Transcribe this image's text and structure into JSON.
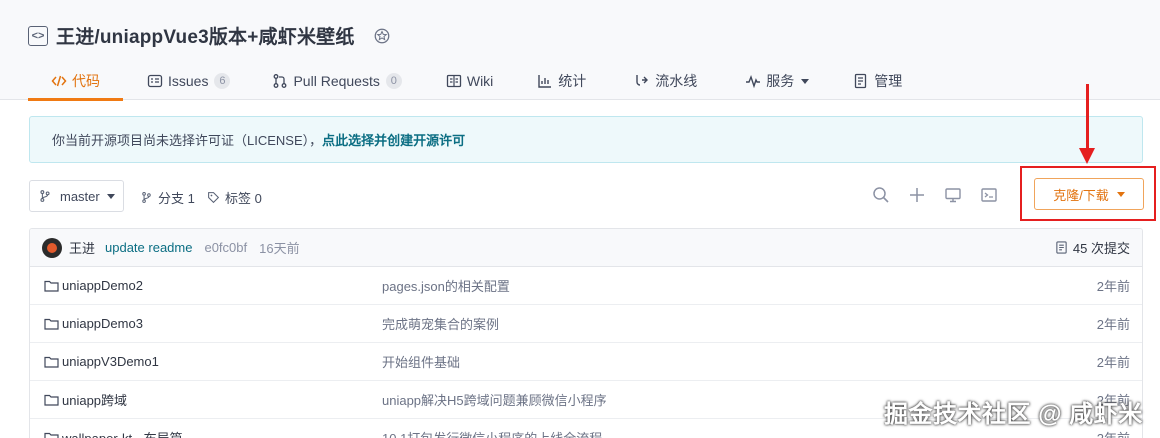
{
  "repo": {
    "title": "王进/uniappVue3版本+咸虾米壁纸"
  },
  "tabs": [
    {
      "label": "代码",
      "icon": "code-icon"
    },
    {
      "label": "Issues",
      "icon": "issues-icon",
      "count": "6"
    },
    {
      "label": "Pull Requests",
      "icon": "pull-request-icon",
      "count": "0"
    },
    {
      "label": "Wiki",
      "icon": "wiki-icon"
    },
    {
      "label": "统计",
      "icon": "chart-icon"
    },
    {
      "label": "流水线",
      "icon": "pipeline-icon"
    },
    {
      "label": "服务",
      "icon": "service-icon"
    },
    {
      "label": "管理",
      "icon": "manage-icon"
    }
  ],
  "notice": {
    "text": "你当前开源项目尚未选择许可证（LICENSE），",
    "link": "点此选择并创建开源许可"
  },
  "branch": {
    "name": "master"
  },
  "meta": {
    "branches": "分支 1",
    "tags": "标签 0"
  },
  "clone": {
    "label": "克隆/下载"
  },
  "latest_commit": {
    "author": "王进",
    "message": "update readme",
    "sha": "e0fc0bf",
    "ago": "16天前",
    "total": "45 次提交"
  },
  "files": [
    {
      "name": "uniappDemo2",
      "message": "pages.json的相关配置",
      "date": "2年前"
    },
    {
      "name": "uniappDemo3",
      "message": "完成萌宠集合的案例",
      "date": "2年前"
    },
    {
      "name": "uniappV3Demo1",
      "message": "开始组件基础",
      "date": "2年前"
    },
    {
      "name": "uniapp跨域",
      "message": "uniapp解决H5跨域问题兼顾微信小程序",
      "date": "2年前"
    },
    {
      "name": "wallpaper-kt - 布局篇",
      "message": "10.1打包发行微信小程序的上线全流程",
      "date": "2年前"
    }
  ],
  "watermark": {
    "text": "掘金技术社区 @ 咸虾米"
  },
  "colors": {
    "accent": "#e2730f",
    "link": "#0b6e83",
    "annotation": "#e51f1f"
  }
}
